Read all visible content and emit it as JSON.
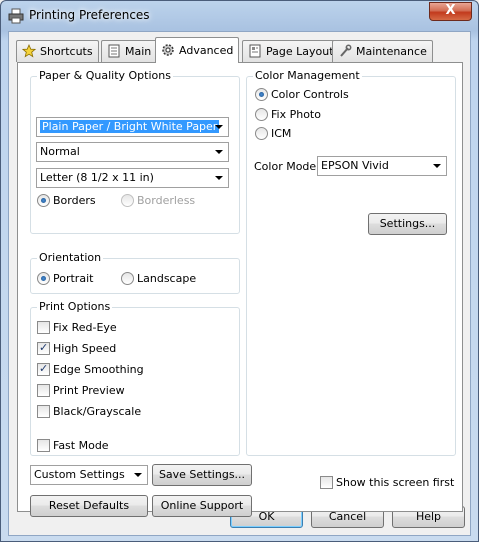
{
  "window": {
    "title": "Printing Preferences",
    "close_glyph": "X"
  },
  "tabs": [
    {
      "label": "Shortcuts",
      "icon": "star-icon"
    },
    {
      "label": "Main",
      "icon": "printer-page-icon"
    },
    {
      "label": "Advanced",
      "icon": "gear-icon",
      "active": true
    },
    {
      "label": "Page Layout",
      "icon": "page-layout-icon"
    },
    {
      "label": "Maintenance",
      "icon": "wrench-icon"
    }
  ],
  "paper_quality": {
    "title": "Paper & Quality Options",
    "paper_type": "Plain Paper / Bright White Paper",
    "quality": "Normal",
    "paper_size": "Letter (8 1/2 x 11 in)",
    "borders_label": "Borders",
    "borderless_label": "Borderless"
  },
  "orientation": {
    "title": "Orientation",
    "portrait_label": "Portrait",
    "landscape_label": "Landscape"
  },
  "print_options": {
    "title": "Print Options",
    "items": [
      {
        "label": "Fix Red-Eye",
        "checked": false
      },
      {
        "label": "High Speed",
        "checked": true
      },
      {
        "label": "Edge Smoothing",
        "checked": true
      },
      {
        "label": "Print Preview",
        "checked": false
      },
      {
        "label": "Black/Grayscale",
        "checked": false
      }
    ],
    "fast_mode_label": "Fast Mode"
  },
  "color_management": {
    "title": "Color Management",
    "color_controls_label": "Color Controls",
    "fix_photo_label": "Fix Photo",
    "icm_label": "ICM",
    "color_mode_label": "Color Mode",
    "color_mode_value": "EPSON Vivid",
    "settings_button": "Settings..."
  },
  "bottom": {
    "custom_settings": "Custom Settings",
    "save_settings": "Save Settings...",
    "reset_defaults": "Reset Defaults",
    "online_support": "Online Support",
    "show_screen_first": "Show this screen first"
  },
  "dialog_buttons": {
    "ok": "OK",
    "cancel": "Cancel",
    "help": "Help"
  },
  "colors": {
    "selection": "#3399ff",
    "title_bar": "#bcd3ec",
    "close_button": "#c23a1d"
  }
}
